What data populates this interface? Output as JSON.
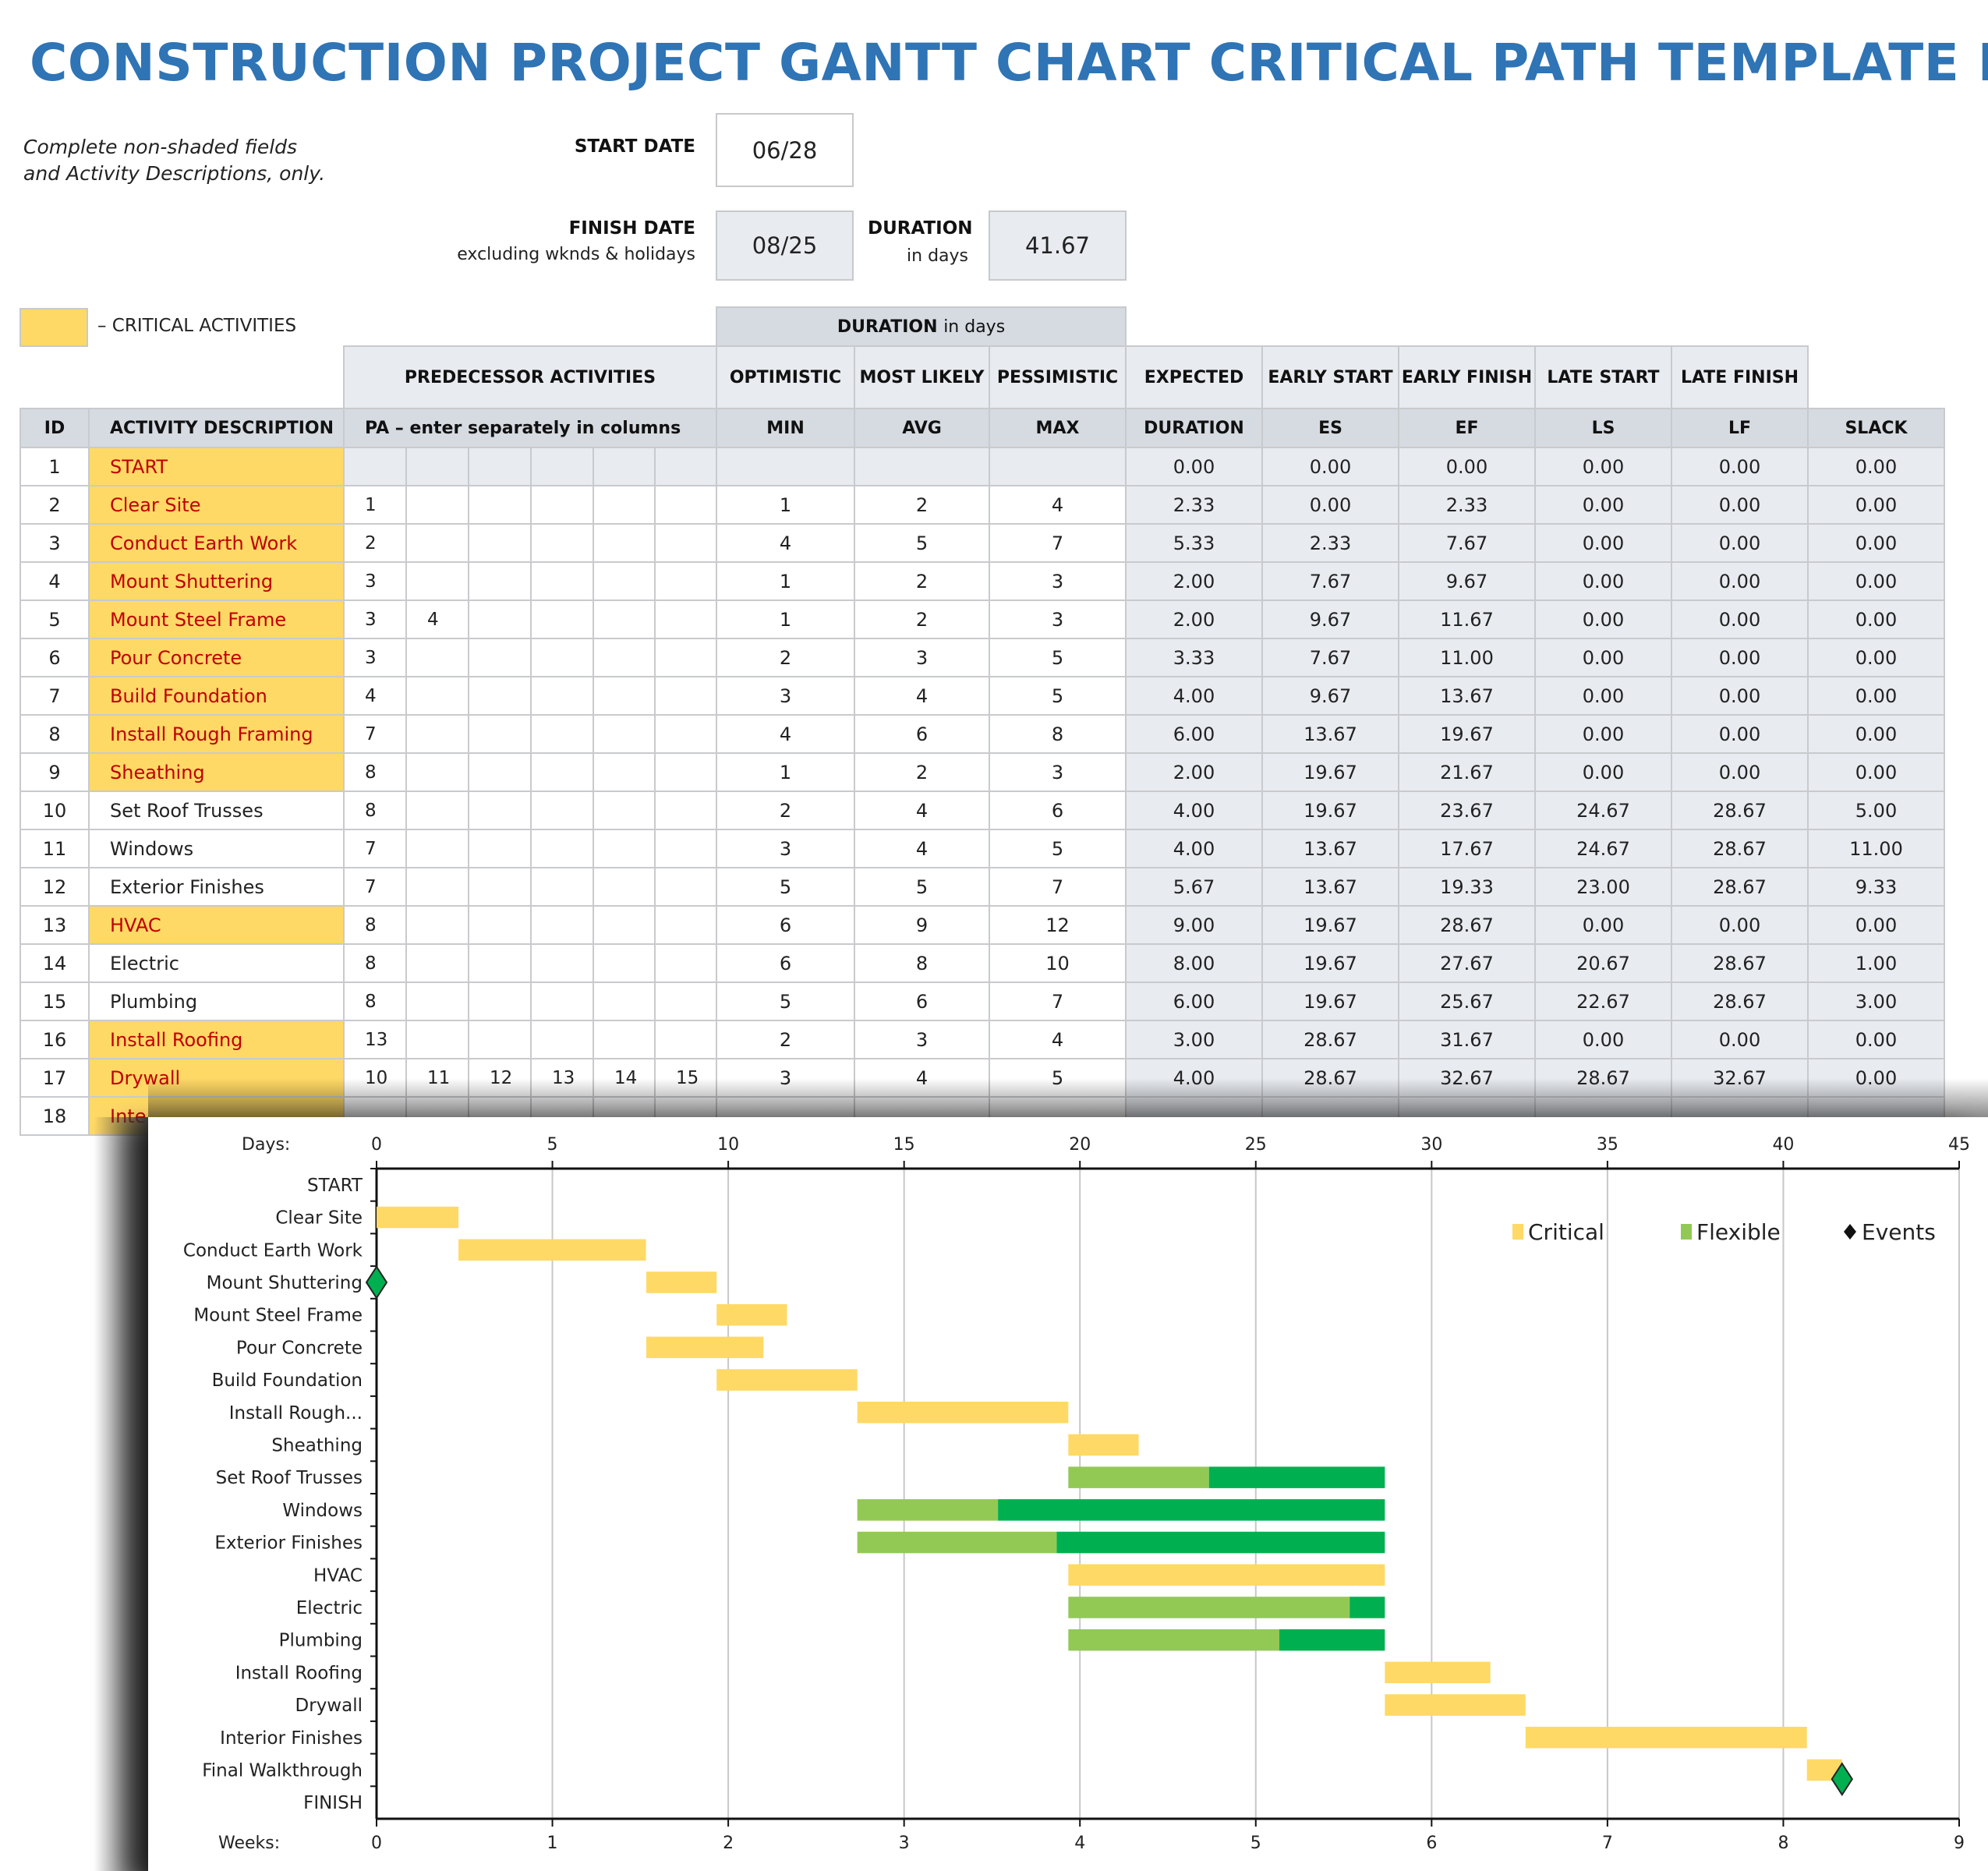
{
  "title": "CONSTRUCTION PROJECT GANTT CHART CRITICAL PATH TEMPLATE EXAMPLE",
  "instructions": [
    "Complete non-shaded fields",
    "and Activity Descriptions, only."
  ],
  "start_date": {
    "label": "START DATE",
    "value": "06/28"
  },
  "finish_date": {
    "label": "FINISH DATE",
    "sublabel": "excluding wknds & holidays",
    "value": "08/25"
  },
  "duration": {
    "label": "DURATION",
    "sublabel": "in days",
    "value": "41.67"
  },
  "legend_critical": "– CRITICAL ACTIVITIES",
  "colors": {
    "critical": "#FFD966",
    "critical_text": "#C00000",
    "flexible_light": "#92C955",
    "flexible_dark": "#00B050",
    "title": "#2F74B5",
    "event": "#00B050"
  },
  "table": {
    "group_header": {
      "duration_in_days": "DURATION",
      "duration_in_days_suffix": "in days"
    },
    "header_top": {
      "predecessor": "PREDECESSOR ACTIVITIES",
      "optimistic": "OPTIMISTIC",
      "most_likely": "MOST LIKELY",
      "pessimistic": "PESSIMISTIC",
      "expected": "EXPECTED",
      "early_start": "EARLY START",
      "early_finish": "EARLY FINISH",
      "late_start": "LATE START",
      "late_finish": "LATE FINISH"
    },
    "header_bottom": {
      "id": "ID",
      "activity": "ACTIVITY DESCRIPTION",
      "pa": "PA  –  enter separately in columns",
      "min": "MIN",
      "avg": "AVG",
      "max": "MAX",
      "duration": "DURATION",
      "es": "ES",
      "ef": "EF",
      "ls": "LS",
      "lf": "LF",
      "slack": "SLACK"
    },
    "rows": [
      {
        "id": "1",
        "activity": "START",
        "critical": true,
        "pa": [
          "",
          "",
          "",
          "",
          "",
          ""
        ],
        "min": "",
        "avg": "",
        "max": "",
        "duration": "0.00",
        "es": "0.00",
        "ef": "0.00",
        "ls": "0.00",
        "lf": "0.00",
        "slack": "0.00"
      },
      {
        "id": "2",
        "activity": "Clear Site",
        "critical": true,
        "pa": [
          "1",
          "",
          "",
          "",
          "",
          ""
        ],
        "min": "1",
        "avg": "2",
        "max": "4",
        "duration": "2.33",
        "es": "0.00",
        "ef": "2.33",
        "ls": "0.00",
        "lf": "0.00",
        "slack": "0.00"
      },
      {
        "id": "3",
        "activity": "Conduct Earth Work",
        "critical": true,
        "pa": [
          "2",
          "",
          "",
          "",
          "",
          ""
        ],
        "min": "4",
        "avg": "5",
        "max": "7",
        "duration": "5.33",
        "es": "2.33",
        "ef": "7.67",
        "ls": "0.00",
        "lf": "0.00",
        "slack": "0.00"
      },
      {
        "id": "4",
        "activity": "Mount Shuttering",
        "critical": true,
        "pa": [
          "3",
          "",
          "",
          "",
          "",
          ""
        ],
        "min": "1",
        "avg": "2",
        "max": "3",
        "duration": "2.00",
        "es": "7.67",
        "ef": "9.67",
        "ls": "0.00",
        "lf": "0.00",
        "slack": "0.00"
      },
      {
        "id": "5",
        "activity": "Mount Steel Frame",
        "critical": true,
        "pa": [
          "3",
          "4",
          "",
          "",
          "",
          ""
        ],
        "min": "1",
        "avg": "2",
        "max": "3",
        "duration": "2.00",
        "es": "9.67",
        "ef": "11.67",
        "ls": "0.00",
        "lf": "0.00",
        "slack": "0.00"
      },
      {
        "id": "6",
        "activity": "Pour Concrete",
        "critical": true,
        "pa": [
          "3",
          "",
          "",
          "",
          "",
          ""
        ],
        "min": "2",
        "avg": "3",
        "max": "5",
        "duration": "3.33",
        "es": "7.67",
        "ef": "11.00",
        "ls": "0.00",
        "lf": "0.00",
        "slack": "0.00"
      },
      {
        "id": "7",
        "activity": "Build Foundation",
        "critical": true,
        "pa": [
          "4",
          "",
          "",
          "",
          "",
          ""
        ],
        "min": "3",
        "avg": "4",
        "max": "5",
        "duration": "4.00",
        "es": "9.67",
        "ef": "13.67",
        "ls": "0.00",
        "lf": "0.00",
        "slack": "0.00"
      },
      {
        "id": "8",
        "activity": "Install Rough Framing",
        "critical": true,
        "pa": [
          "7",
          "",
          "",
          "",
          "",
          ""
        ],
        "min": "4",
        "avg": "6",
        "max": "8",
        "duration": "6.00",
        "es": "13.67",
        "ef": "19.67",
        "ls": "0.00",
        "lf": "0.00",
        "slack": "0.00"
      },
      {
        "id": "9",
        "activity": "Sheathing",
        "critical": true,
        "pa": [
          "8",
          "",
          "",
          "",
          "",
          ""
        ],
        "min": "1",
        "avg": "2",
        "max": "3",
        "duration": "2.00",
        "es": "19.67",
        "ef": "21.67",
        "ls": "0.00",
        "lf": "0.00",
        "slack": "0.00"
      },
      {
        "id": "10",
        "activity": "Set Roof Trusses",
        "critical": false,
        "pa": [
          "8",
          "",
          "",
          "",
          "",
          ""
        ],
        "min": "2",
        "avg": "4",
        "max": "6",
        "duration": "4.00",
        "es": "19.67",
        "ef": "23.67",
        "ls": "24.67",
        "lf": "28.67",
        "slack": "5.00"
      },
      {
        "id": "11",
        "activity": "Windows",
        "critical": false,
        "pa": [
          "7",
          "",
          "",
          "",
          "",
          ""
        ],
        "min": "3",
        "avg": "4",
        "max": "5",
        "duration": "4.00",
        "es": "13.67",
        "ef": "17.67",
        "ls": "24.67",
        "lf": "28.67",
        "slack": "11.00"
      },
      {
        "id": "12",
        "activity": "Exterior Finishes",
        "critical": false,
        "pa": [
          "7",
          "",
          "",
          "",
          "",
          ""
        ],
        "min": "5",
        "avg": "5",
        "max": "7",
        "duration": "5.67",
        "es": "13.67",
        "ef": "19.33",
        "ls": "23.00",
        "lf": "28.67",
        "slack": "9.33"
      },
      {
        "id": "13",
        "activity": "HVAC",
        "critical": true,
        "pa": [
          "8",
          "",
          "",
          "",
          "",
          ""
        ],
        "min": "6",
        "avg": "9",
        "max": "12",
        "duration": "9.00",
        "es": "19.67",
        "ef": "28.67",
        "ls": "0.00",
        "lf": "0.00",
        "slack": "0.00"
      },
      {
        "id": "14",
        "activity": "Electric",
        "critical": false,
        "pa": [
          "8",
          "",
          "",
          "",
          "",
          ""
        ],
        "min": "6",
        "avg": "8",
        "max": "10",
        "duration": "8.00",
        "es": "19.67",
        "ef": "27.67",
        "ls": "20.67",
        "lf": "28.67",
        "slack": "1.00"
      },
      {
        "id": "15",
        "activity": "Plumbing",
        "critical": false,
        "pa": [
          "8",
          "",
          "",
          "",
          "",
          ""
        ],
        "min": "5",
        "avg": "6",
        "max": "7",
        "duration": "6.00",
        "es": "19.67",
        "ef": "25.67",
        "ls": "22.67",
        "lf": "28.67",
        "slack": "3.00"
      },
      {
        "id": "16",
        "activity": "Install Roofing",
        "critical": true,
        "pa": [
          "13",
          "",
          "",
          "",
          "",
          ""
        ],
        "min": "2",
        "avg": "3",
        "max": "4",
        "duration": "3.00",
        "es": "28.67",
        "ef": "31.67",
        "ls": "0.00",
        "lf": "0.00",
        "slack": "0.00"
      },
      {
        "id": "17",
        "activity": "Drywall",
        "critical": true,
        "pa": [
          "10",
          "11",
          "12",
          "13",
          "14",
          "15"
        ],
        "min": "3",
        "avg": "4",
        "max": "5",
        "duration": "4.00",
        "es": "28.67",
        "ef": "32.67",
        "ls": "28.67",
        "lf": "32.67",
        "slack": "0.00"
      },
      {
        "id": "18",
        "activity": "Inte",
        "critical": true,
        "pa": [
          "",
          "",
          "",
          "",
          "",
          ""
        ],
        "min": "",
        "avg": "",
        "max": "",
        "duration": "",
        "es": "",
        "ef": "",
        "ls": "",
        "lf": "",
        "slack": ""
      }
    ]
  },
  "chart_data": {
    "type": "bar",
    "subtype": "gantt-stacked-horizontal",
    "x_axis_top": {
      "label": "Days:",
      "range": [
        0,
        45
      ],
      "ticks": [
        0,
        5,
        10,
        15,
        20,
        25,
        30,
        35,
        40,
        45
      ]
    },
    "x_axis_bottom": {
      "label": "Weeks:",
      "range": [
        0,
        9
      ],
      "ticks": [
        0,
        1,
        2,
        3,
        4,
        5,
        6,
        7,
        8,
        9
      ]
    },
    "grid": true,
    "legend": {
      "position": "top-right",
      "entries": [
        "Critical",
        "Flexible",
        "Events"
      ]
    },
    "categories": [
      "START",
      "Clear Site",
      "Conduct Earth Work",
      "Mount Shuttering",
      "Mount Steel Frame",
      "Pour Concrete",
      "Build Foundation",
      "Install Rough...",
      "Sheathing",
      "Set Roof Trusses",
      "Windows",
      "Exterior Finishes",
      "HVAC",
      "Electric",
      "Plumbing",
      "Install Roofing",
      "Drywall",
      "Interior Finishes",
      "Final Walkthrough",
      "FINISH"
    ],
    "series": [
      {
        "name": "Critical",
        "kind": "critical",
        "bars": [
          {
            "category": "Clear Site",
            "start": 0.0,
            "duration": 2.33
          },
          {
            "category": "Conduct Earth Work",
            "start": 2.33,
            "duration": 5.33
          },
          {
            "category": "Mount Shuttering",
            "start": 7.67,
            "duration": 2.0
          },
          {
            "category": "Mount Steel Frame",
            "start": 9.67,
            "duration": 2.0
          },
          {
            "category": "Pour Concrete",
            "start": 7.67,
            "duration": 3.33
          },
          {
            "category": "Build Foundation",
            "start": 9.67,
            "duration": 4.0
          },
          {
            "category": "Install Rough...",
            "start": 13.67,
            "duration": 6.0
          },
          {
            "category": "Sheathing",
            "start": 19.67,
            "duration": 2.0
          },
          {
            "category": "HVAC",
            "start": 19.67,
            "duration": 9.0
          },
          {
            "category": "Install Roofing",
            "start": 28.67,
            "duration": 3.0
          },
          {
            "category": "Drywall",
            "start": 28.67,
            "duration": 4.0
          },
          {
            "category": "Interior Finishes",
            "start": 32.67,
            "duration": 8.0
          },
          {
            "category": "Final Walkthrough",
            "start": 40.67,
            "duration": 1.0
          }
        ]
      },
      {
        "name": "Flexible",
        "kind": "flexible",
        "bars": [
          {
            "category": "Set Roof Trusses",
            "start": 19.67,
            "duration": 4.0,
            "slack": 5.0
          },
          {
            "category": "Windows",
            "start": 13.67,
            "duration": 4.0,
            "slack": 11.0
          },
          {
            "category": "Exterior Finishes",
            "start": 13.67,
            "duration": 5.67,
            "slack": 9.33
          },
          {
            "category": "Electric",
            "start": 19.67,
            "duration": 8.0,
            "slack": 1.0
          },
          {
            "category": "Plumbing",
            "start": 19.67,
            "duration": 6.0,
            "slack": 3.0
          }
        ]
      },
      {
        "name": "Events",
        "kind": "event",
        "points": [
          {
            "category": "Mount Shuttering",
            "x": 0.0
          },
          {
            "category": "Final Walkthrough",
            "x": 41.67
          }
        ]
      }
    ]
  }
}
